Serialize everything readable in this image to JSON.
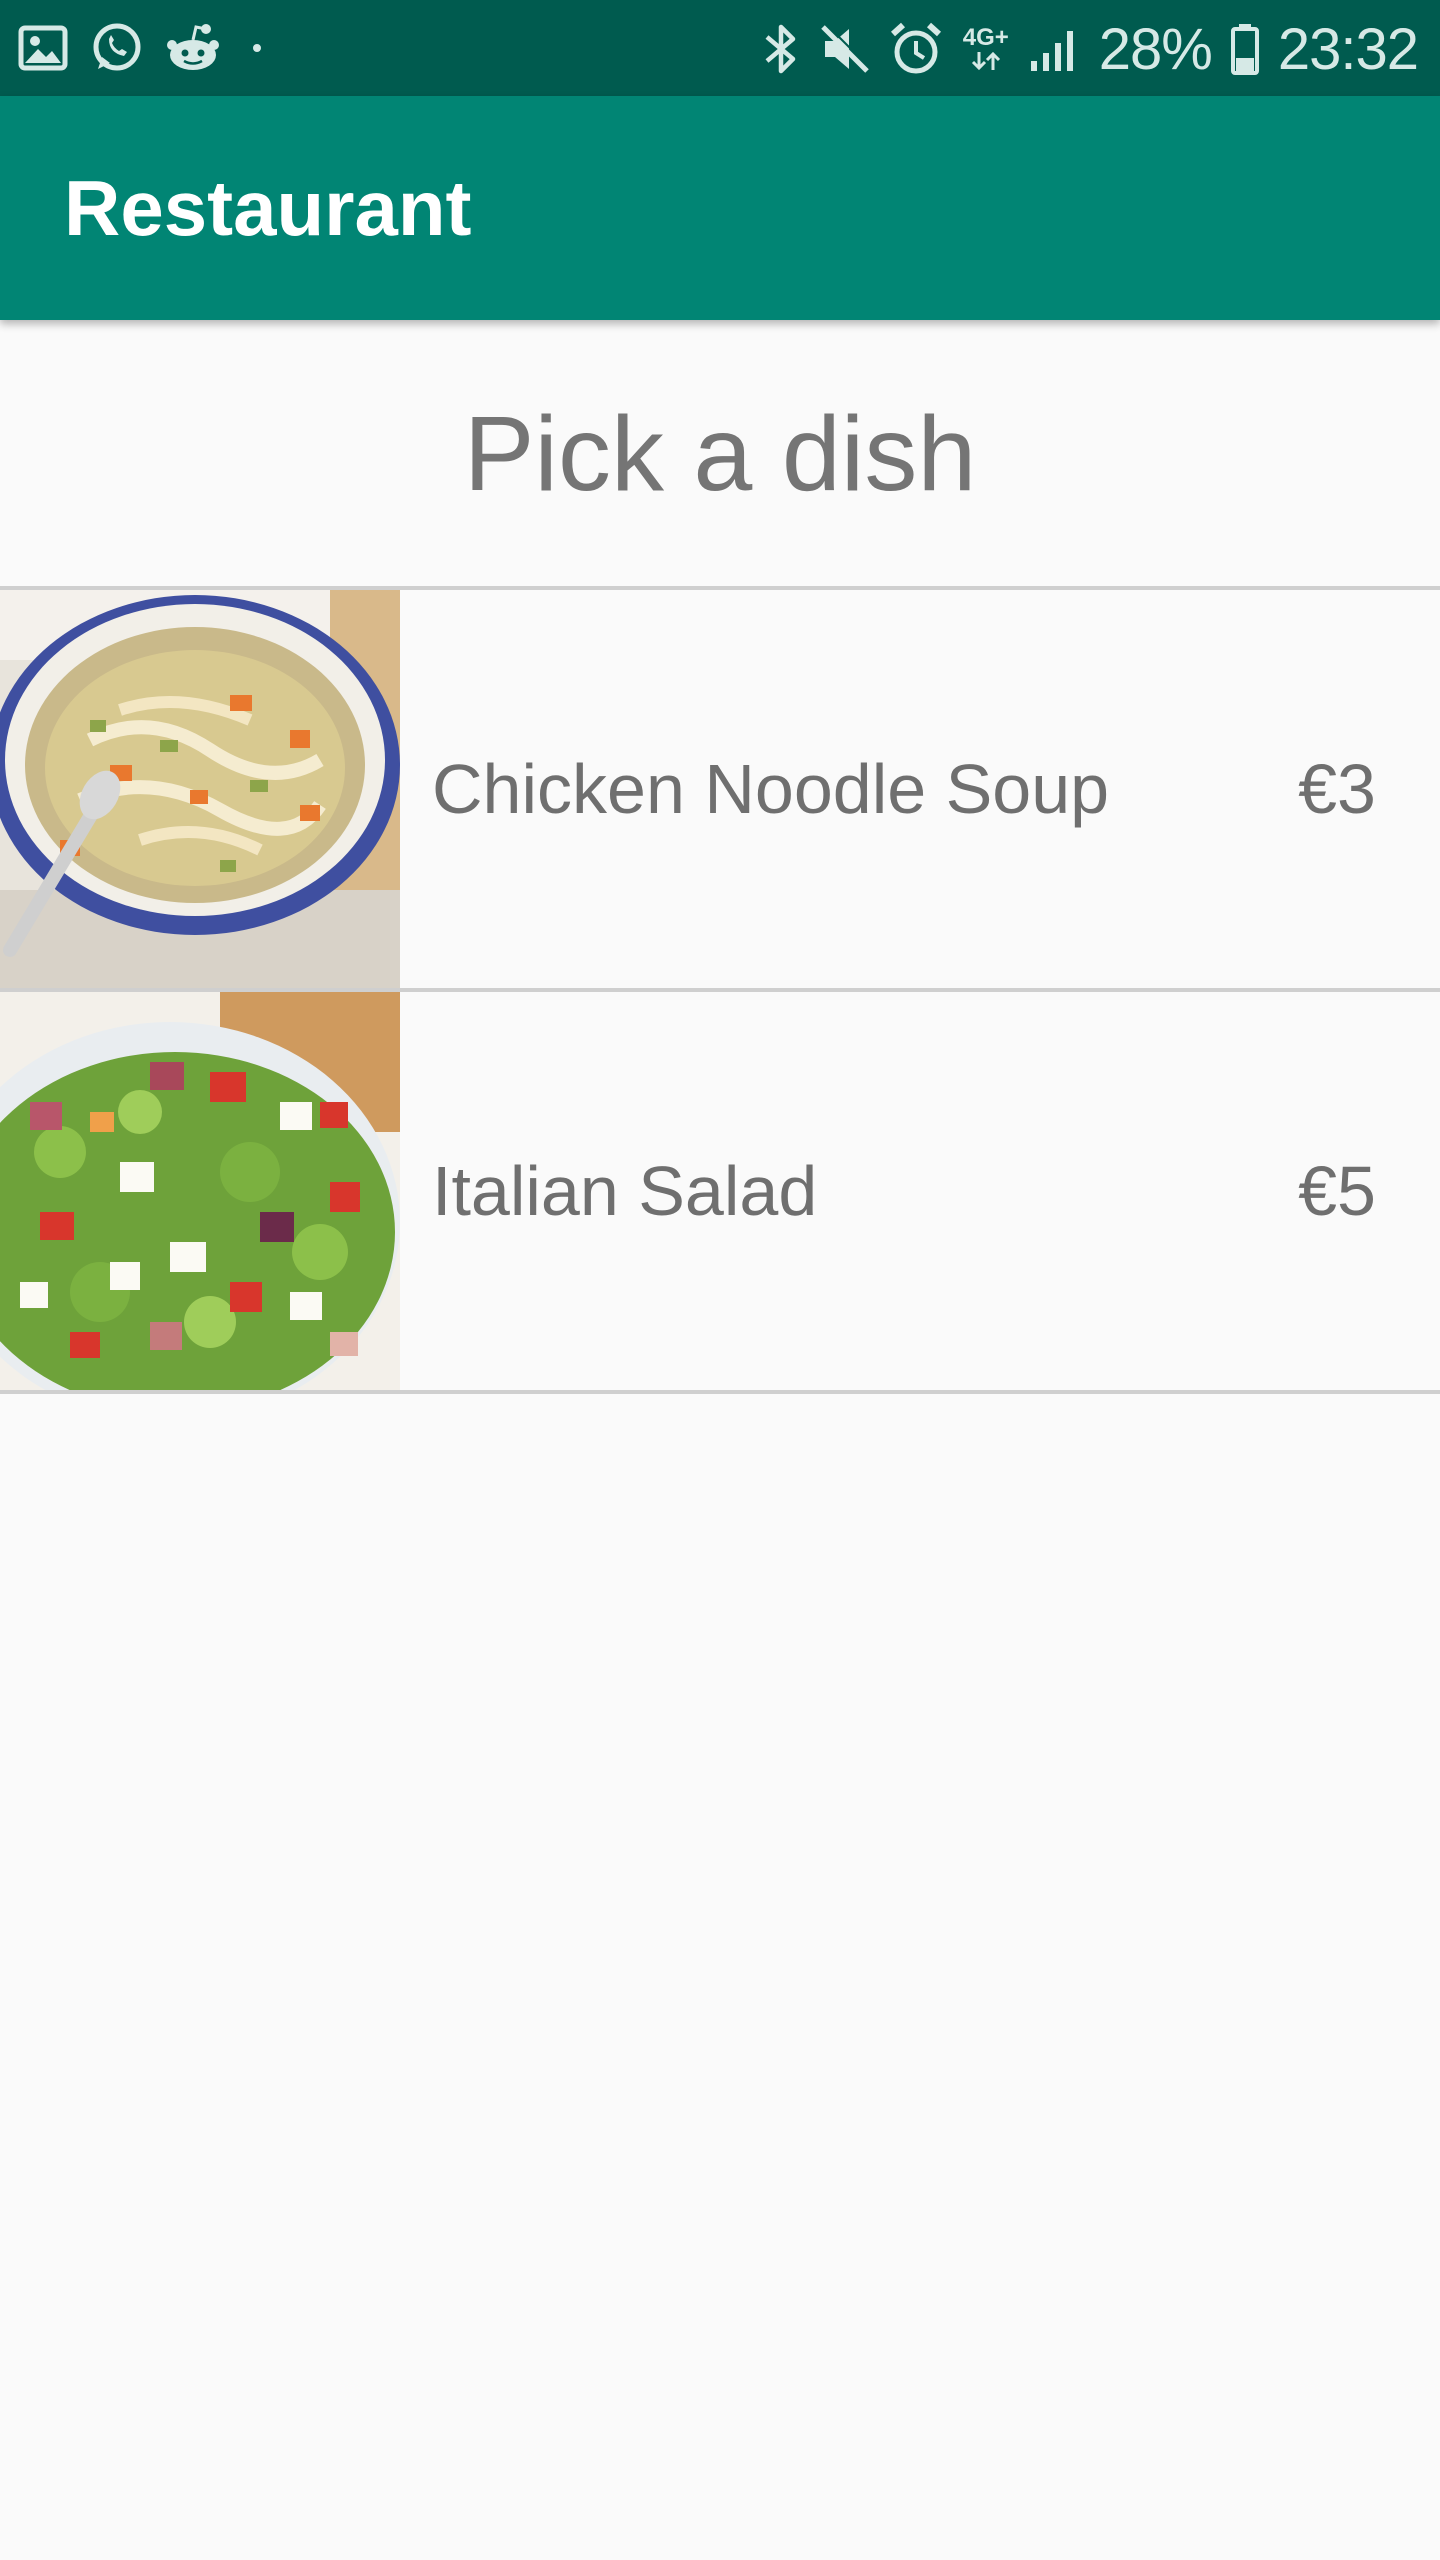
{
  "status_bar": {
    "left_icons": [
      "gallery-icon",
      "whatsapp-icon",
      "reddit-icon",
      "dot-icon"
    ],
    "right_icons": [
      "bluetooth-icon",
      "mute-icon",
      "alarm-icon",
      "network-4g-icon",
      "signal-icon",
      "battery-icon"
    ],
    "network": "4G+",
    "battery": "28%",
    "time": "23:32"
  },
  "app_bar": {
    "title": "Restaurant"
  },
  "heading": "Pick a dish",
  "dishes": [
    {
      "name": "Chicken Noodle Soup",
      "price": "€3",
      "image_icon": "chicken-noodle-soup-photo"
    },
    {
      "name": "Italian Salad",
      "price": "€5",
      "image_icon": "italian-salad-photo"
    }
  ],
  "colors": {
    "status_bar": "#005b4f",
    "app_bar": "#018574",
    "background": "#fafafa",
    "text": "#757575",
    "divider": "#cfcfcf"
  }
}
